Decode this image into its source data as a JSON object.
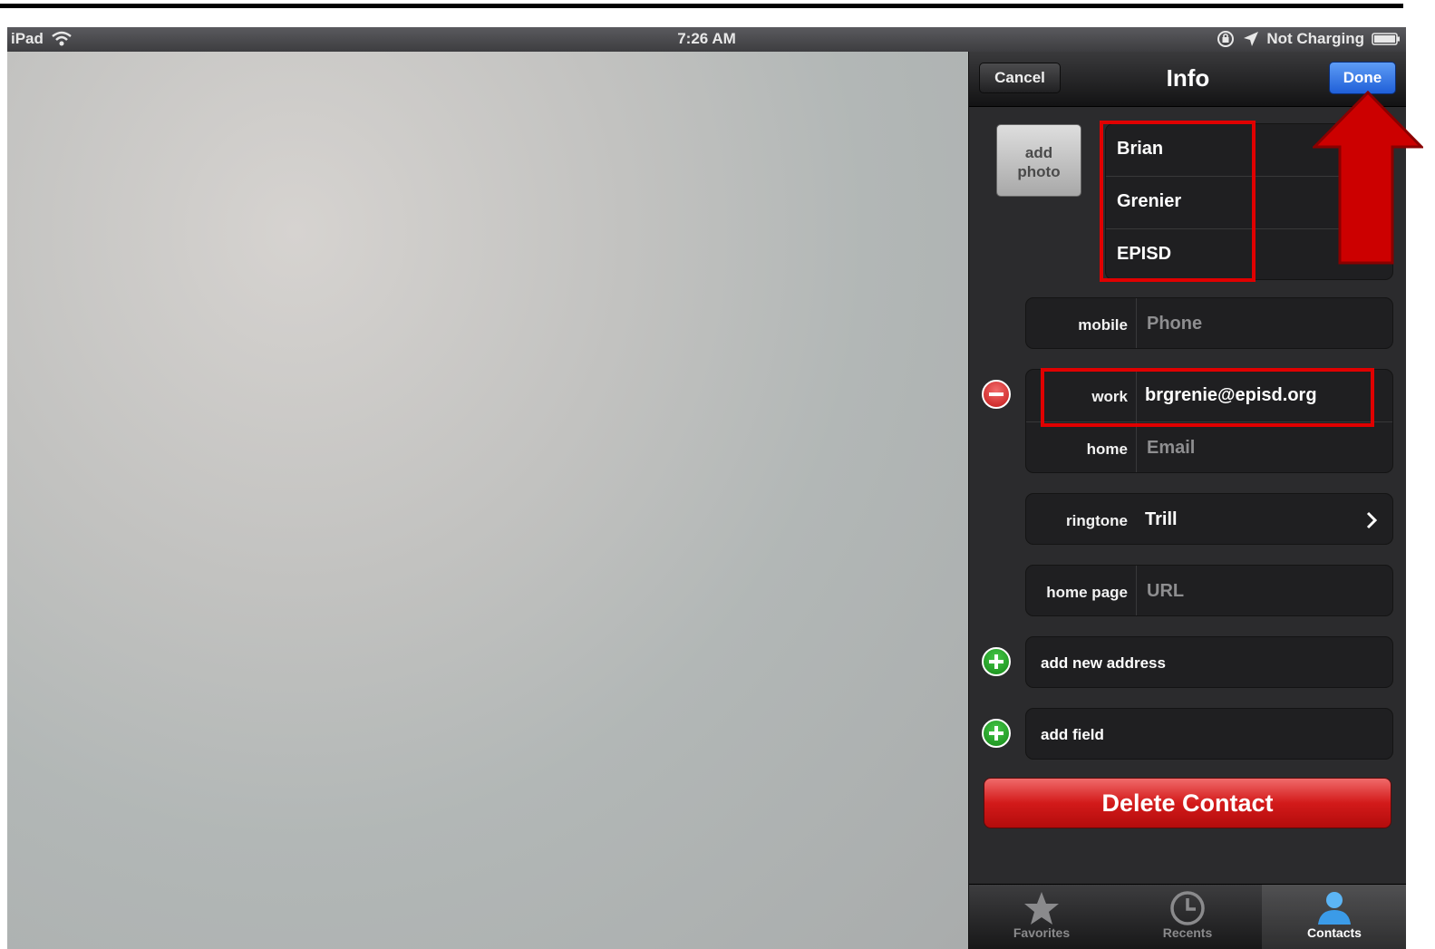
{
  "status_bar": {
    "device": "iPad",
    "time": "7:26 AM",
    "charging": "Not Charging"
  },
  "navbar": {
    "cancel": "Cancel",
    "title": "Info",
    "done": "Done"
  },
  "add_photo": {
    "line1": "add",
    "line2": "photo"
  },
  "name": {
    "first": "Brian",
    "last": "Grenier",
    "company": "EPISD"
  },
  "phone": {
    "label": "mobile",
    "placeholder": "Phone"
  },
  "email": {
    "work_label": "work",
    "work_value": "brgrenie@episd.org",
    "home_label": "home",
    "home_placeholder": "Email"
  },
  "ringtone": {
    "label": "ringtone",
    "value": "Trill"
  },
  "home_page": {
    "label": "home page",
    "placeholder": "URL"
  },
  "add_address": "add new address",
  "add_field": "add field",
  "delete_contact": "Delete Contact",
  "tabs": [
    {
      "label": "Favorites",
      "icon": "star-icon",
      "selected": false
    },
    {
      "label": "Recents",
      "icon": "clock-icon",
      "selected": false
    },
    {
      "label": "Contacts",
      "icon": "person-icon",
      "selected": true
    }
  ],
  "colors": {
    "done_button": "#2a6be0",
    "delete_button": "#d31a1a",
    "annotation": "#e00000",
    "add_icon": "#1e9b21",
    "remove_icon": "#d42020"
  }
}
